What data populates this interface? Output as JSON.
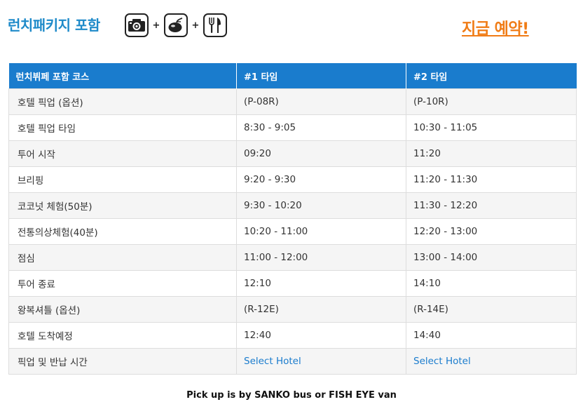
{
  "header": {
    "title": "런치패키지 포함",
    "icons": [
      "camera-icon",
      "coconut-icon",
      "fork-knife-icon"
    ],
    "plus": "+",
    "book_now": "지금 예약!",
    "title_color": "#1e8ac9",
    "book_color": "#f07c16"
  },
  "table": {
    "headers": [
      "런치뷔페 포함 코스",
      "#1 타임",
      "#2 타임"
    ],
    "rows": [
      {
        "label": "호텔 픽업 (옵션)",
        "t1": "(P-08R)",
        "t2": "(P-10R)"
      },
      {
        "label": "호텔 픽업 타임",
        "t1": "8:30 - 9:05",
        "t2": "10:30 - 11:05"
      },
      {
        "label": "투어 시작",
        "t1": "09:20",
        "t2": "11:20"
      },
      {
        "label": "브리핑",
        "t1": "9:20 - 9:30",
        "t2": "11:20 - 11:30"
      },
      {
        "label": "코코넛 체험(50분)",
        "t1": "9:30 - 10:20",
        "t2": "11:30 - 12:20"
      },
      {
        "label": "전통의상체험(40분)",
        "t1": "10:20 - 11:00",
        "t2": "12:20 - 13:00"
      },
      {
        "label": "점심",
        "t1": "11:00 - 12:00",
        "t2": "13:00 - 14:00"
      },
      {
        "label": "투어 종료",
        "t1": "12:10",
        "t2": "14:10"
      },
      {
        "label": "왕복셔틀 (옵션)",
        "t1": "(R-12E)",
        "t2": "(R-14E)"
      },
      {
        "label": "호텔 도착예정",
        "t1": "12:40",
        "t2": "14:40"
      },
      {
        "label": "픽업 및 반납 시간",
        "t1": "Select Hotel",
        "t2": "Select Hotel"
      }
    ],
    "header_color": "#1a7ccd",
    "link_color": "#1a7ccd"
  },
  "footer": {
    "note": "Pick up is by SANKO bus or FISH EYE van"
  }
}
